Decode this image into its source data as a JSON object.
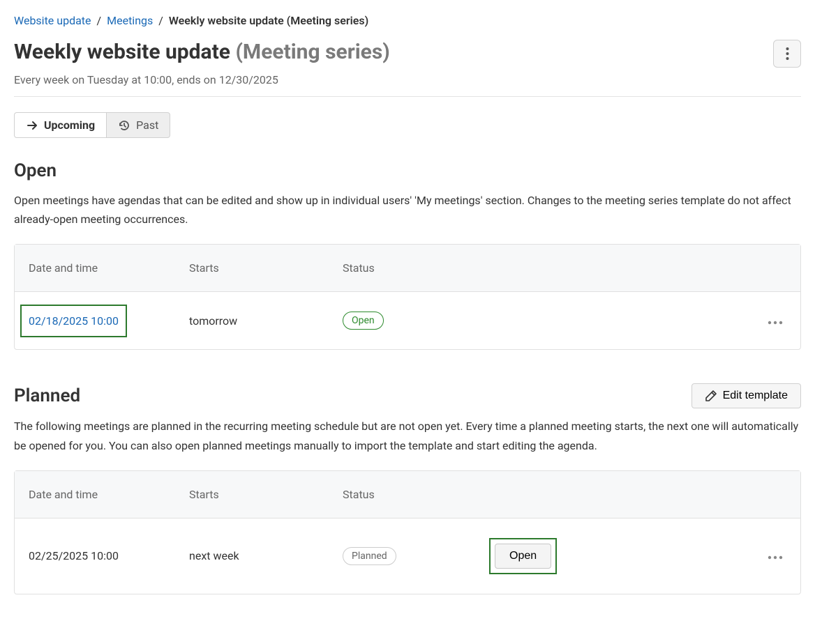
{
  "breadcrumb": {
    "root": "Website update",
    "mid": "Meetings",
    "current": "Weekly website update (Meeting series)"
  },
  "header": {
    "title": "Weekly website update",
    "suffix": "(Meeting series)",
    "schedule": "Every week on Tuesday at 10:00, ends on 12/30/2025"
  },
  "tabs": {
    "upcoming": "Upcoming",
    "past": "Past"
  },
  "open_section": {
    "title": "Open",
    "description": "Open meetings have agendas that can be edited and show up in individual users' 'My meetings' section. Changes to the meeting series template do not affect already-open meeting occurrences.",
    "columns": {
      "datetime": "Date and time",
      "starts": "Starts",
      "status": "Status"
    },
    "row": {
      "datetime": "02/18/2025 10:00",
      "starts": "tomorrow",
      "status": "Open"
    }
  },
  "planned_section": {
    "title": "Planned",
    "edit_template_label": "Edit template",
    "description": "The following meetings are planned in the recurring meeting schedule but are not open yet. Every time a planned meeting starts, the next one will automatically be opened for you. You can also open planned meetings manually to import the template and start editing the agenda.",
    "columns": {
      "datetime": "Date and time",
      "starts": "Starts",
      "status": "Status"
    },
    "row": {
      "datetime": "02/25/2025 10:00",
      "starts": "next week",
      "status": "Planned",
      "open_label": "Open"
    }
  }
}
